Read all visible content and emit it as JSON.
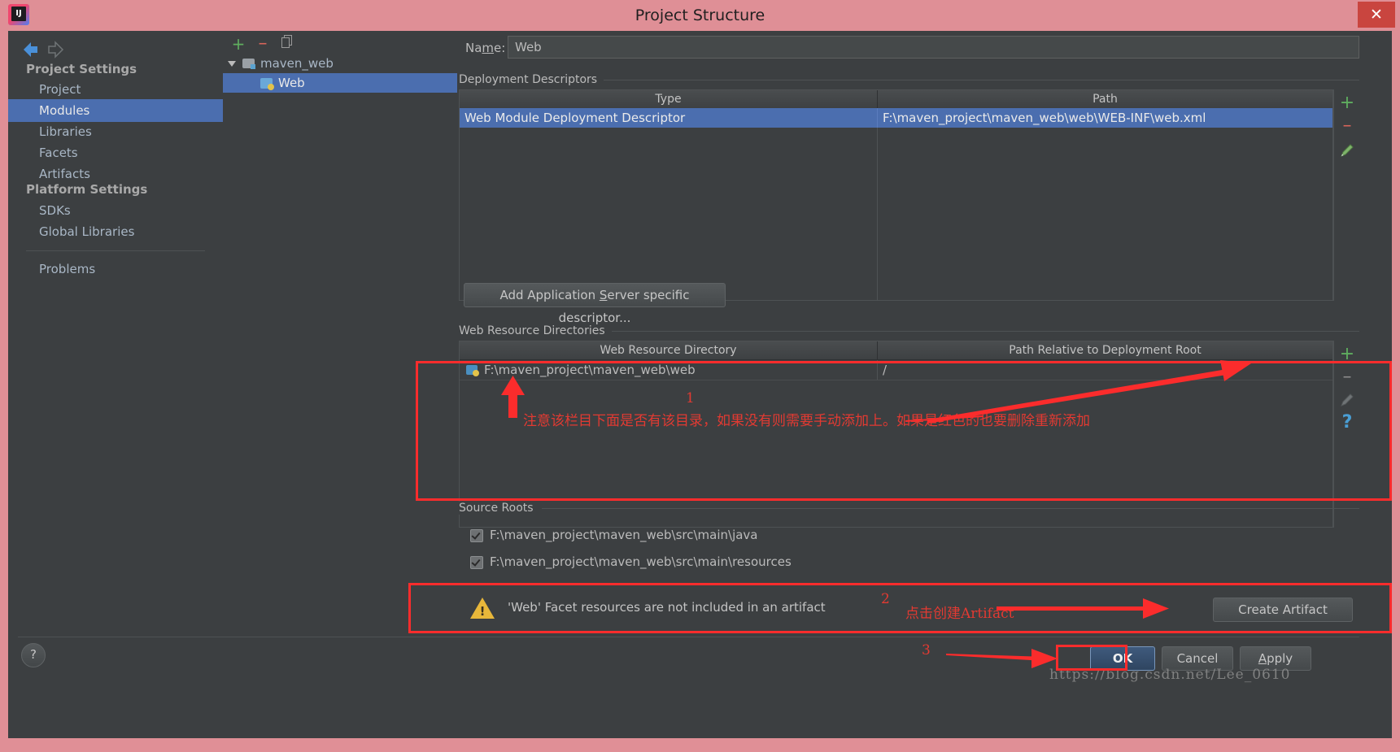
{
  "window": {
    "title": "Project Structure",
    "close_label": "✕",
    "app_icon": "intellij-idea-icon"
  },
  "sidebar": {
    "nav": {
      "back": "back-arrow-icon",
      "forward": "forward-arrow-icon"
    },
    "groups": [
      {
        "label": "Project Settings"
      },
      {
        "label": "Platform Settings"
      }
    ],
    "items": [
      {
        "label": "Project",
        "selected": false
      },
      {
        "label": "Modules",
        "selected": true
      },
      {
        "label": "Libraries",
        "selected": false
      },
      {
        "label": "Facets",
        "selected": false
      },
      {
        "label": "Artifacts",
        "selected": false
      },
      {
        "label": "SDKs",
        "selected": false
      },
      {
        "label": "Global Libraries",
        "selected": false
      },
      {
        "label": "Problems",
        "selected": false
      }
    ],
    "help_label": "?"
  },
  "tree": {
    "toolbar": {
      "add": "+",
      "remove": "–",
      "copy": "copy-icon"
    },
    "nodes": [
      {
        "label": "maven_web",
        "selected": false
      },
      {
        "label": "Web",
        "selected": true
      }
    ]
  },
  "main": {
    "name_label_pre": "Na",
    "name_label_accel": "m",
    "name_label_post": "e:",
    "name_value": "Web",
    "deployment": {
      "section_label": "Deployment Descriptors",
      "columns": [
        "Type",
        "Path"
      ],
      "rows": [
        {
          "type": "Web Module Deployment Descriptor",
          "path": "F:\\maven_project\\maven_web\\web\\WEB-INF\\web.xml",
          "selected": true
        }
      ],
      "tools": {
        "add": "+",
        "remove": "–",
        "edit": "pencil-icon"
      }
    },
    "add_descriptor_button_pre": "Add Application ",
    "add_descriptor_button_accel": "S",
    "add_descriptor_button_post": "erver specific descriptor...",
    "web_resources": {
      "section_label": "Web Resource Directories",
      "columns": [
        "Web Resource Directory",
        "Path Relative to Deployment Root"
      ],
      "rows": [
        {
          "directory": "F:\\maven_project\\maven_web\\web",
          "relative_path": "/"
        }
      ],
      "tools": {
        "add": "+",
        "remove": "–",
        "edit": "pencil-icon",
        "help": "?"
      }
    },
    "source_roots": {
      "section_label": "Source Roots",
      "rows": [
        {
          "path": "F:\\maven_project\\maven_web\\src\\main\\java",
          "checked": true
        },
        {
          "path": "F:\\maven_project\\maven_web\\src\\main\\resources",
          "checked": true
        }
      ]
    },
    "warning": {
      "icon": "warning-triangle-icon",
      "text": "'Web' Facet resources are not included in an artifact",
      "action_label": "Create Artifact"
    }
  },
  "footer": {
    "ok_label": "OK",
    "cancel_label": "Cancel",
    "apply_label_accel": "A",
    "apply_label_post": "pply"
  },
  "annotations": {
    "marker_1": "1",
    "marker_2": "2",
    "marker_3": "3",
    "note_1": "注意该栏目下面是否有该目录，如果没有则需要手动添加上。如果是红色的也要删除重新添加",
    "note_2": "点击创建Artifact",
    "watermark": "https://blog.csdn.net/Lee_0610",
    "color": "#fb2c2c"
  }
}
